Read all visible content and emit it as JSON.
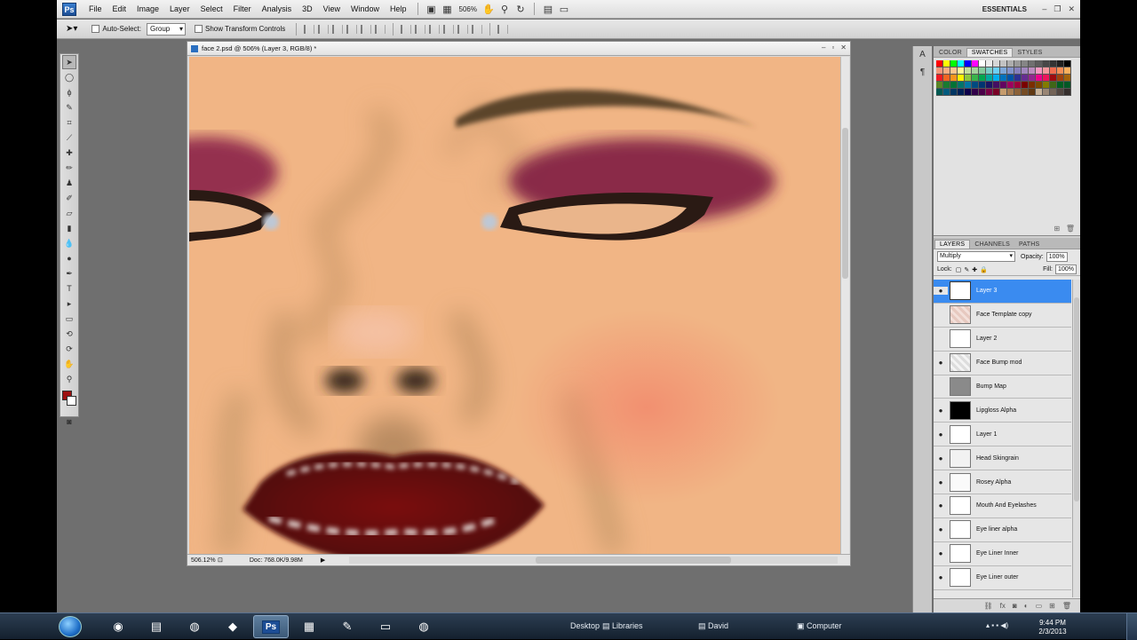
{
  "menubar": {
    "logo": "Ps",
    "items": [
      "File",
      "Edit",
      "Image",
      "Layer",
      "Select",
      "Filter",
      "Analysis",
      "3D",
      "View",
      "Window",
      "Help"
    ],
    "zoom": "506%",
    "workspace": "ESSENTIALS"
  },
  "optionsbar": {
    "auto_select_label": "Auto-Select:",
    "auto_select_value": "Group",
    "transform_label": "Show Transform Controls"
  },
  "document": {
    "title": "face 2.psd @ 506% (Layer 3, RGB/8) *",
    "zoom": "506.12%",
    "doc_info": "Doc: 768.0K/9.98M"
  },
  "panels": {
    "top_tabs": [
      "COLOR",
      "SWATCHES",
      "STYLES"
    ],
    "layer_tabs": [
      "LAYERS",
      "CHANNELS",
      "PATHS"
    ],
    "blend_mode": "Multiply",
    "opacity_label": "Opacity:",
    "opacity": "100%",
    "lock_label": "Lock:",
    "fill_label": "Fill:",
    "fill": "100%"
  },
  "layers": [
    {
      "name": "Layer 3",
      "visible": true,
      "selected": true
    },
    {
      "name": "Face Template copy",
      "visible": false,
      "selected": false
    },
    {
      "name": "Layer 2",
      "visible": false,
      "selected": false
    },
    {
      "name": "Face Bump mod",
      "visible": true,
      "selected": false
    },
    {
      "name": "Bump Map",
      "visible": false,
      "selected": false
    },
    {
      "name": "Lipgloss Alpha",
      "visible": true,
      "selected": false
    },
    {
      "name": "Layer 1",
      "visible": true,
      "selected": false
    },
    {
      "name": "Head Skingrain",
      "visible": true,
      "selected": false
    },
    {
      "name": "Rosey Alpha",
      "visible": true,
      "selected": false
    },
    {
      "name": "Mouth And Eyelashes",
      "visible": true,
      "selected": false
    },
    {
      "name": "Eye liner alpha",
      "visible": true,
      "selected": false
    },
    {
      "name": "Eye Liner Inner",
      "visible": true,
      "selected": false
    },
    {
      "name": "Eye Liner outer",
      "visible": true,
      "selected": false
    }
  ],
  "taskbar": {
    "desktop": "Desktop",
    "libraries": "Libraries",
    "user": "David",
    "computer": "Computer",
    "time": "9:44 PM",
    "date": "2/3/2013"
  },
  "colors": {
    "foreground": "#9e1010",
    "background": "#ffffff",
    "selection": "#3a8bf0"
  }
}
